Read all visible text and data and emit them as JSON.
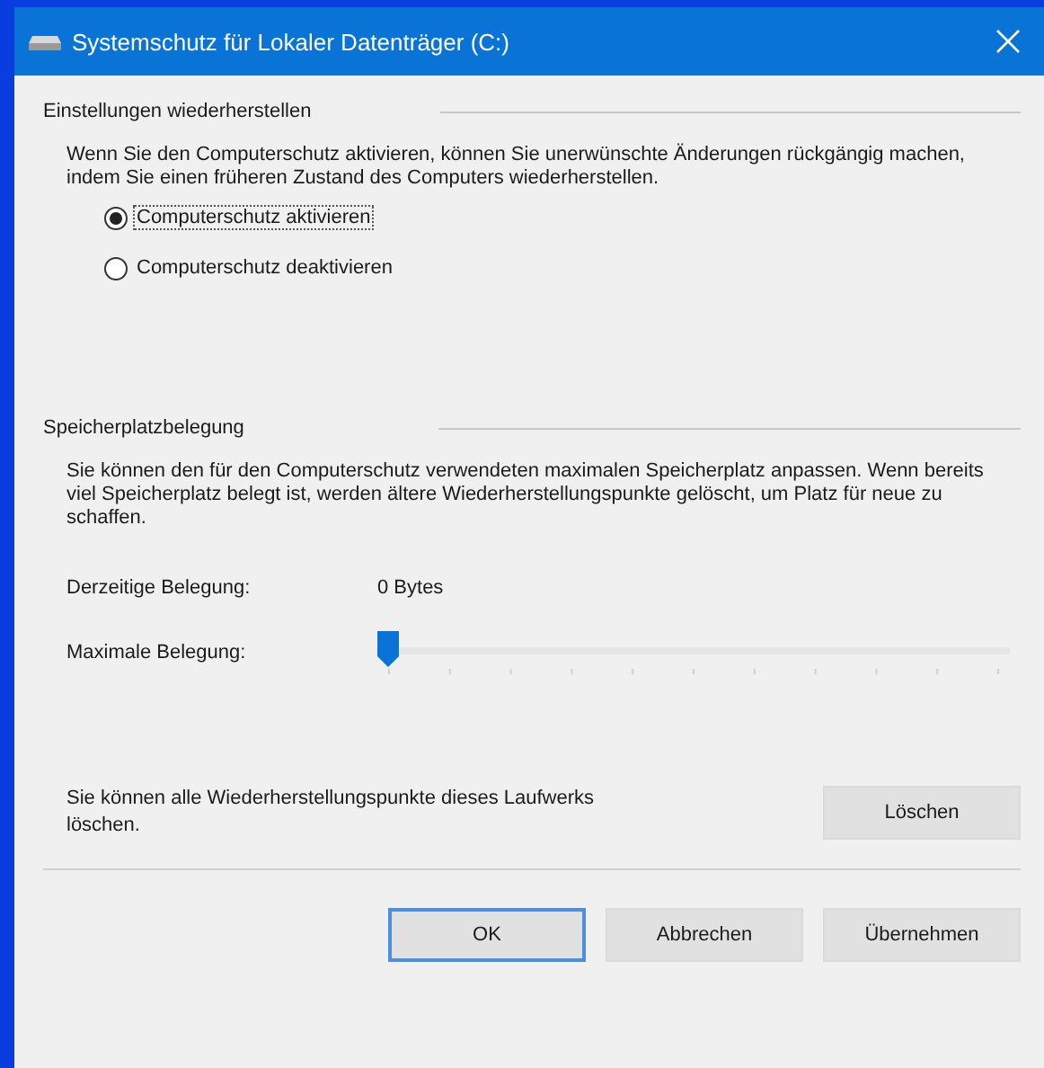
{
  "window": {
    "title": "Systemschutz für Lokaler Datenträger (C:)"
  },
  "restore_settings": {
    "heading": "Einstellungen wiederherstellen",
    "description": "Wenn Sie den Computerschutz aktivieren, können Sie unerwünschte Änderungen rückgängig machen, indem Sie einen früheren Zustand des Computers wiederherstellen.",
    "options": [
      {
        "label": "Computerschutz aktivieren",
        "selected": true
      },
      {
        "label": "Computerschutz deaktivieren",
        "selected": false
      }
    ]
  },
  "disk_usage": {
    "heading": "Speicherplatzbelegung",
    "description": "Sie können den für den Computerschutz verwendeten maximalen Speicherplatz anpassen. Wenn bereits viel Speicherplatz belegt ist, werden ältere Wiederherstellungspunkte gelöscht, um Platz für neue zu schaffen.",
    "current_label": "Derzeitige Belegung:",
    "current_value": "0 Bytes",
    "max_label": "Maximale Belegung:",
    "max_slider": {
      "level": 0
    }
  },
  "delete": {
    "text": "Sie können alle Wiederherstellungspunkte dieses Laufwerks löschen.",
    "button": "Löschen"
  },
  "buttons": [
    {
      "label": "OK",
      "default": true
    },
    {
      "label": "Abbrechen",
      "default": false
    },
    {
      "label": "Übernehmen",
      "default": false
    }
  ]
}
